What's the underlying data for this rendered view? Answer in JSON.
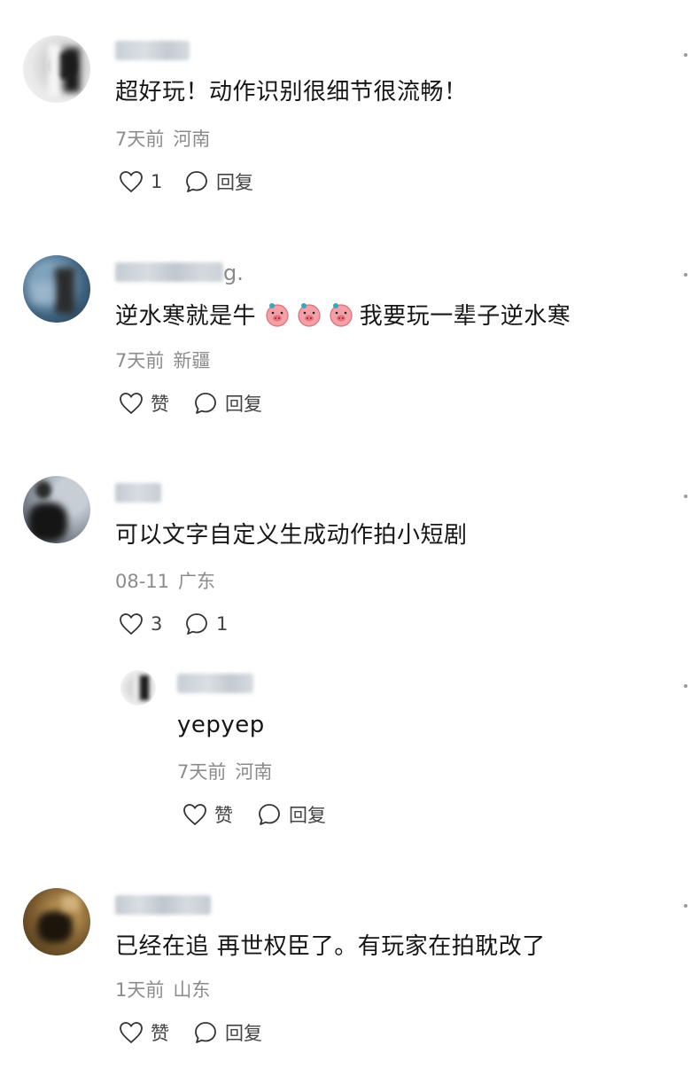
{
  "comments": [
    {
      "text": "超好玩！动作识别很细节很流畅！",
      "time": "7天前",
      "location": "河南",
      "likes": "1",
      "reply_label": "回复"
    },
    {
      "username_tail": "g.",
      "text_before": "逆水寒就是牛",
      "text_after": "我要玩一辈子逆水寒",
      "emoji_icon": "pig-face-emoji",
      "time": "7天前",
      "location": "新疆",
      "like_label": "赞",
      "reply_label": "回复"
    },
    {
      "text": "可以文字自定义生成动作拍小短剧",
      "time": "08-11",
      "location": "广东",
      "likes": "3",
      "replies": "1",
      "reply": {
        "text": "yepyep",
        "time": "7天前",
        "location": "河南",
        "like_label": "赞",
        "reply_label": "回复"
      }
    },
    {
      "text": "已经在追 再世权臣了。有玩家在拍耽改了",
      "time": "1天前",
      "location": "山东",
      "like_label": "赞",
      "reply_label": "回复"
    }
  ]
}
